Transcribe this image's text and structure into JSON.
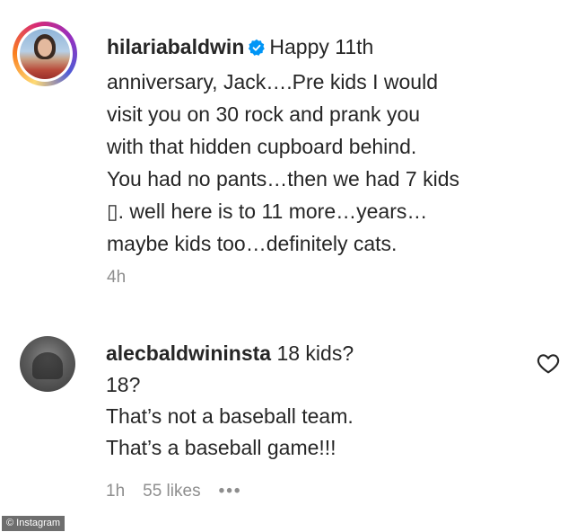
{
  "caption": {
    "username": "hilariabaldwin",
    "verified_icon": "verified-badge-icon",
    "lines": [
      "Happy 11th",
      "anniversary, Jack….Pre kids I would",
      "visit you on 30 rock and prank you",
      "with that hidden cupboard behind.",
      "You had no pants…then we had 7 kids",
      "▯. well here is to 11 more…years…",
      "maybe kids too…definitely cats."
    ],
    "time": "4h"
  },
  "reply": {
    "username": "alecbaldwininsta",
    "first_line_rest": "18 kids?",
    "lines": [
      "18?",
      "That’s not a baseball team.",
      "That’s a baseball game!!!"
    ],
    "time": "1h",
    "likes": "55 likes",
    "more": "•••",
    "like_icon": "heart-outline-icon"
  },
  "watermark": {
    "text": "© Instagram"
  },
  "colors": {
    "text": "#262626",
    "secondary": "#8e8e8e",
    "verified": "#0095f6"
  }
}
